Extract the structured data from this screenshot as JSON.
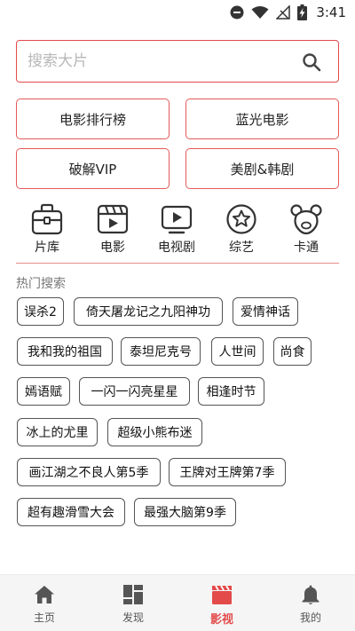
{
  "status_bar": {
    "time": "3:41",
    "icons": [
      "minus-circle-icon",
      "wifi-icon",
      "no-signal-icon",
      "battery-charging-icon"
    ]
  },
  "search": {
    "placeholder": "搜索大片",
    "value": "",
    "icon": "search-icon",
    "accent_color": "#e34a4a"
  },
  "quick_buttons": [
    {
      "label": "电影排行榜"
    },
    {
      "label": "蓝光电影"
    },
    {
      "label": "破解VIP"
    },
    {
      "label": "美剧&韩剧"
    }
  ],
  "categories": [
    {
      "label": "片库",
      "icon": "toolbox-icon"
    },
    {
      "label": "电影",
      "icon": "film-clapper-icon"
    },
    {
      "label": "电视剧",
      "icon": "tv-play-icon"
    },
    {
      "label": "综艺",
      "icon": "star-circle-icon"
    },
    {
      "label": "卡通",
      "icon": "bear-icon"
    }
  ],
  "hot_search": {
    "title": "热门搜索",
    "tags": [
      "误杀2",
      "倚天屠龙记之九阳神功",
      "爱情神话",
      "我和我的祖国",
      "泰坦尼克号",
      "人世间",
      "尚食",
      "嫣语赋",
      "一闪一闪亮星星",
      "相逢时节",
      "冰上的尤里",
      "超级小熊布迷",
      "画江湖之不良人第5季",
      "王牌对王牌第7季",
      "超有趣滑雪大会",
      "最强大脑第9季"
    ]
  },
  "bottom_nav": {
    "items": [
      {
        "label": "主页",
        "icon": "home-icon",
        "active": false
      },
      {
        "label": "发现",
        "icon": "grid-icon",
        "active": false
      },
      {
        "label": "影视",
        "icon": "clapperboard-icon",
        "active": true
      },
      {
        "label": "我的",
        "icon": "bell-icon",
        "active": false
      }
    ],
    "active_color": "#e34a4a",
    "inactive_color": "#555555"
  }
}
